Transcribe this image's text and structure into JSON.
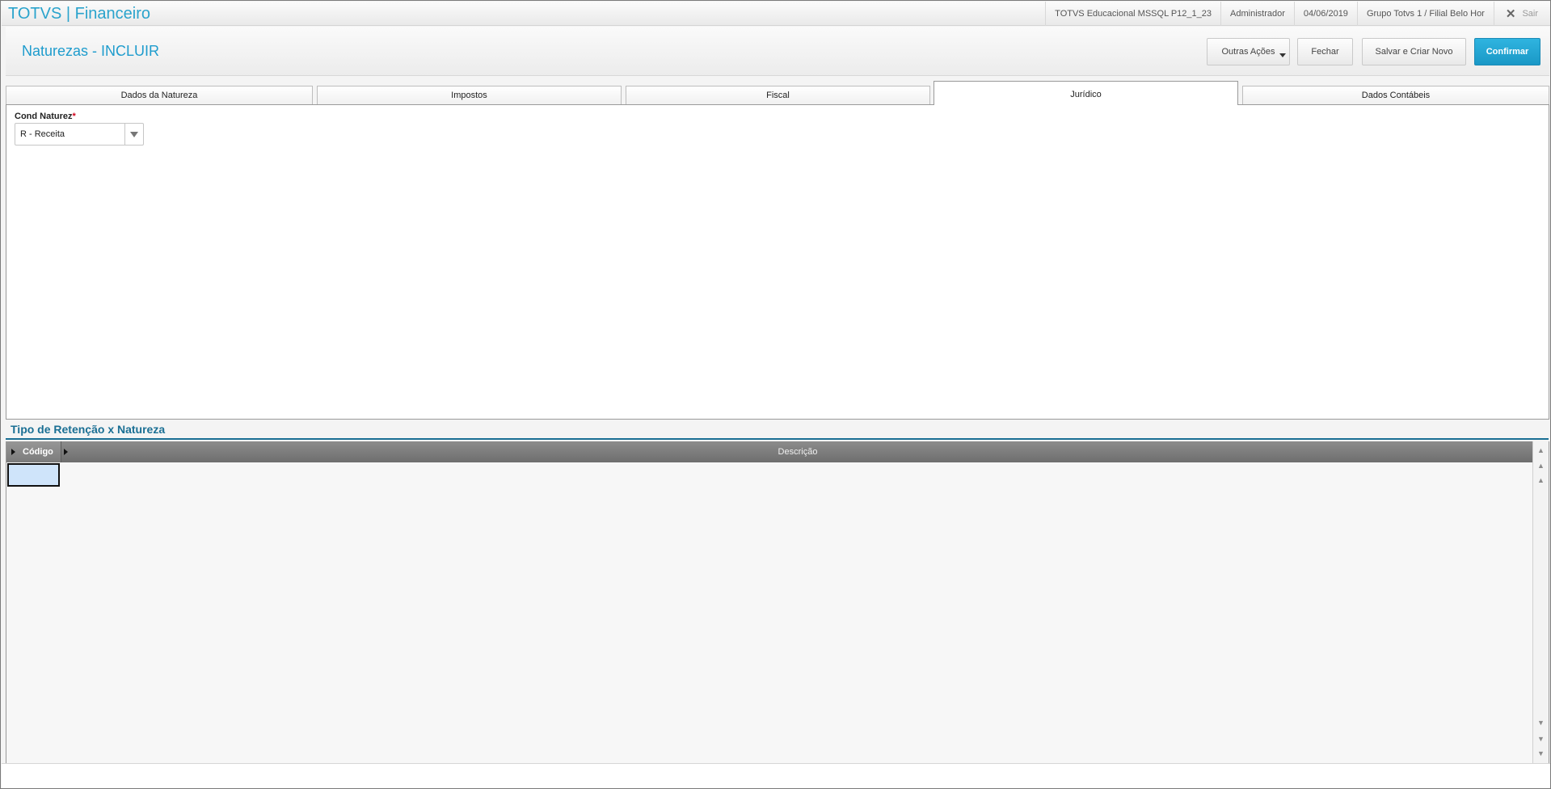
{
  "app": {
    "title": "TOTVS | Financeiro"
  },
  "topbar": {
    "environment": "TOTVS Educacional MSSQL P12_1_23",
    "user": "Administrador",
    "date": "04/06/2019",
    "branch": "Grupo Totvs 1 / Filial Belo Hor",
    "exit_label": "Sair"
  },
  "header": {
    "page_title": "Naturezas - INCLUIR",
    "buttons": {
      "other_actions": "Outras Ações",
      "close": "Fechar",
      "save_new": "Salvar e Criar Novo",
      "confirm": "Confirmar"
    }
  },
  "tabs": [
    {
      "label": "Dados da Natureza",
      "active": false
    },
    {
      "label": "Impostos",
      "active": false
    },
    {
      "label": "Fiscal",
      "active": false
    },
    {
      "label": "Jurídico",
      "active": true
    },
    {
      "label": "Dados Contábeis",
      "active": false
    }
  ],
  "form": {
    "cond_natureza": {
      "label": "Cond Naturez",
      "required_mark": "*",
      "value": "R - Receita"
    }
  },
  "grid": {
    "title": "Tipo de Retenção x Natureza",
    "columns": [
      "Código",
      "Descrição"
    ],
    "rows": []
  },
  "icons": {
    "exit": "close-icon",
    "dropdown": "chevron-down-icon",
    "column_marker": "triangle-right-icon",
    "scroll_up": "arrow-up-icon",
    "scroll_down": "arrow-down-icon"
  },
  "colors": {
    "brand": "#2aa3cc",
    "confirm": "#1a98c6",
    "grid_title": "#1a6f94",
    "required": "#d0021b",
    "selected_cell": "#cfe4fa"
  }
}
